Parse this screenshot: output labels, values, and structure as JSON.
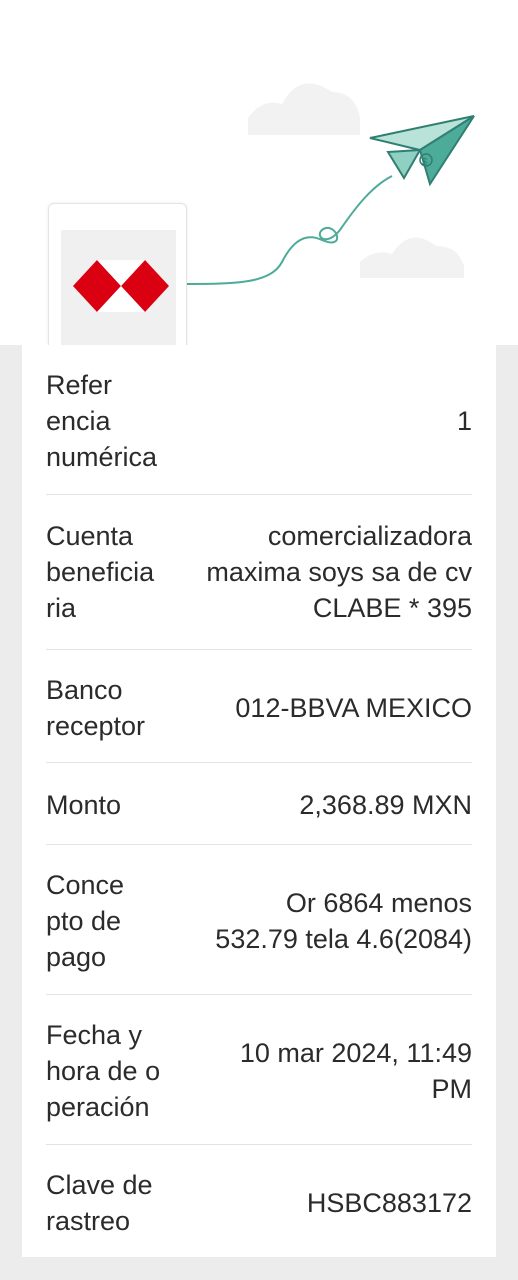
{
  "brand": {
    "logo_icon": "hsbc-hexagon-logo",
    "logo_color": "#db0011"
  },
  "illustration": {
    "icon": "paper-plane-icon",
    "accent": "#4dab9a"
  },
  "details": [
    {
      "label": "Refer\nencia\nnumérica",
      "value": "1"
    },
    {
      "label": "Cuenta\nbeneficia\nria",
      "value": "comercializadora\nmaxima soys sa de cv\nCLABE * 395"
    },
    {
      "label": "Banco\nreceptor",
      "value": "012-BBVA MEXICO"
    },
    {
      "label": "Monto",
      "value": "2,368.89 MXN"
    },
    {
      "label": "Conce\npto de\npago",
      "value": "Or 6864 menos\n532.79 tela 4.6(2084)"
    },
    {
      "label": "Fecha y\nhora de o\nperación",
      "value": "10 mar 2024, 11:49\nPM"
    },
    {
      "label": "Clave de\nrastreo",
      "value": "HSBC883172"
    }
  ]
}
